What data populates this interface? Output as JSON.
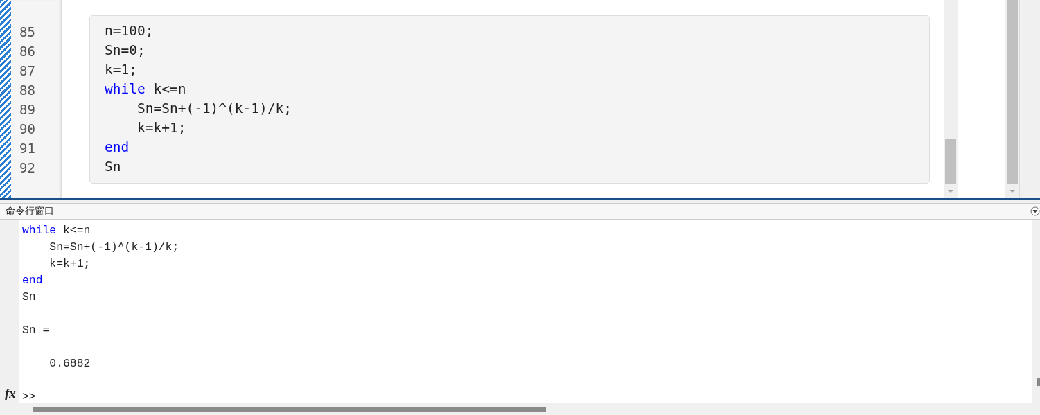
{
  "editor": {
    "lines": [
      {
        "number": "85",
        "tokens": [
          {
            "text": "n=100;",
            "kind": "plain"
          }
        ]
      },
      {
        "number": "86",
        "tokens": [
          {
            "text": "Sn=0;",
            "kind": "plain"
          }
        ]
      },
      {
        "number": "87",
        "tokens": [
          {
            "text": "k=1;",
            "kind": "plain"
          }
        ]
      },
      {
        "number": "88",
        "tokens": [
          {
            "text": "while",
            "kind": "keyword"
          },
          {
            "text": " k<=n",
            "kind": "plain"
          }
        ]
      },
      {
        "number": "89",
        "tokens": [
          {
            "text": "    Sn=Sn+(-1)^(k-1)/k;",
            "kind": "plain"
          }
        ]
      },
      {
        "number": "90",
        "tokens": [
          {
            "text": "    k=k+1;",
            "kind": "plain"
          }
        ]
      },
      {
        "number": "91",
        "tokens": [
          {
            "text": "end",
            "kind": "keyword"
          }
        ]
      },
      {
        "number": "92",
        "tokens": [
          {
            "text": "Sn",
            "kind": "plain"
          }
        ]
      }
    ]
  },
  "command_window": {
    "title": "命令行窗口",
    "lines": [
      {
        "kind": "code",
        "tokens": [
          {
            "text": "while",
            "kind": "keyword"
          },
          {
            "text": " k<=n",
            "kind": "plain"
          }
        ]
      },
      {
        "kind": "code",
        "tokens": [
          {
            "text": "    Sn=Sn+(-1)^(k-1)/k;",
            "kind": "plain"
          }
        ]
      },
      {
        "kind": "code",
        "tokens": [
          {
            "text": "    k=k+1;",
            "kind": "plain"
          }
        ]
      },
      {
        "kind": "code",
        "tokens": [
          {
            "text": "end",
            "kind": "keyword"
          }
        ]
      },
      {
        "kind": "code",
        "tokens": [
          {
            "text": "Sn",
            "kind": "plain"
          }
        ]
      },
      {
        "kind": "blank"
      },
      {
        "kind": "code",
        "tokens": [
          {
            "text": "Sn =",
            "kind": "plain"
          }
        ]
      },
      {
        "kind": "blank"
      },
      {
        "kind": "code",
        "tokens": [
          {
            "text": "    0.6882",
            "kind": "plain"
          }
        ]
      },
      {
        "kind": "blank"
      }
    ],
    "function_button": "fx",
    "prompt": ">>"
  }
}
